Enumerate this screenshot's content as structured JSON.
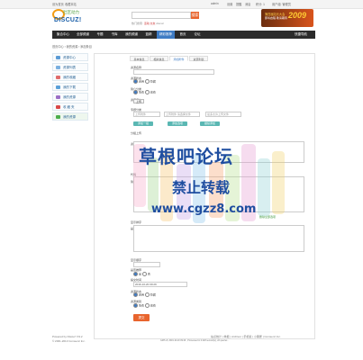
{
  "topbar": {
    "left": [
      "设为首页",
      "收藏本站"
    ],
    "user": "admin",
    "right_items": [
      "设置",
      "提醒",
      "消息",
      "积分: 1",
      "用户组: 管理员"
    ]
  },
  "logo": {
    "tagline": "社区动力",
    "brand": "DISCUZ!"
  },
  "search": {
    "placeholder": "",
    "button": "搜索",
    "hot_label": "热门搜索:",
    "hot_items": [
      "活动",
      "交友",
      "discuz"
    ]
  },
  "banner": {
    "line1": "第四届站长大会",
    "line2": "即将启程 敬请期待",
    "year": "2009"
  },
  "nav": {
    "items": [
      "聚合中心",
      "全部频道",
      "专题",
      "书库",
      "我的频道",
      "蓝精",
      "精彩推荐",
      "首页",
      "论坛"
    ],
    "active_index": 6,
    "right_label": "快捷导航"
  },
  "breadcrumb": "首页中心 › 我的资源 › 添加条目",
  "sidebar": {
    "items": [
      {
        "label": "资源中心",
        "color": "#5b9bd5"
      },
      {
        "label": "资源列表",
        "color": "#7ab0e0"
      },
      {
        "label": "我的收藏",
        "color": "#e06c6c"
      },
      {
        "label": "我的下载",
        "color": "#5aa0d8"
      },
      {
        "label": "我的资源",
        "color": "#9b6fc6"
      },
      {
        "label": "收 藏 夹",
        "color": "#d94848"
      },
      {
        "label": "我的资源",
        "color": "#4cae4c"
      }
    ]
  },
  "tabs": [
    "基本信息",
    "相关信息",
    "添加附件",
    "资源列表"
  ],
  "active_tab": 2,
  "form": {
    "labels": [
      "资源名称",
      "资源状态",
      "简介分类",
      "资源评价",
      "专题分类",
      "分组上传",
      "资源分类",
      "代码",
      "简介资料",
      "显示排序",
      "是否推荐",
      "是否隐藏",
      "资源描述",
      "资源标签",
      "显示顺序",
      "是否推荐",
      "提交时间",
      "资源状态",
      "资源类别"
    ],
    "radio_pairs": [
      {
        "a": "启用",
        "b": "隐藏"
      },
      {
        "a": "免费",
        "b": "收费"
      },
      {
        "a": "是",
        "b": "否"
      },
      {
        "a": "启用",
        "b": "隐藏"
      },
      {
        "a": "免费",
        "b": "收费"
      }
    ],
    "upload_btn": "上传",
    "file_placeholders": [
      "上传附件",
      "上传附件 请选择文件",
      "最多允许上传文件"
    ],
    "teal_btns": [
      "添加一组",
      "添加选项",
      "继续添加"
    ],
    "remove_text": "删除全部选项",
    "date_value": "2016-10-20 09:29",
    "submit": "提交"
  },
  "footer": {
    "powered": "Powered by Discuz! X3.2",
    "copy": "© 2001-2013 Comsenz Inc.",
    "links": [
      "站点统计",
      "举报",
      "Archiver",
      "手机版",
      "小黑屋",
      "Comsenz Inc."
    ],
    "meta": "GMT+8, 2016-10-20 09:29 , Processed in 0.028 second(s), 22 queries ."
  },
  "watermark": {
    "line1": "草根吧论坛",
    "line2": "禁止转载",
    "line3": "www.cgzz8.com"
  }
}
